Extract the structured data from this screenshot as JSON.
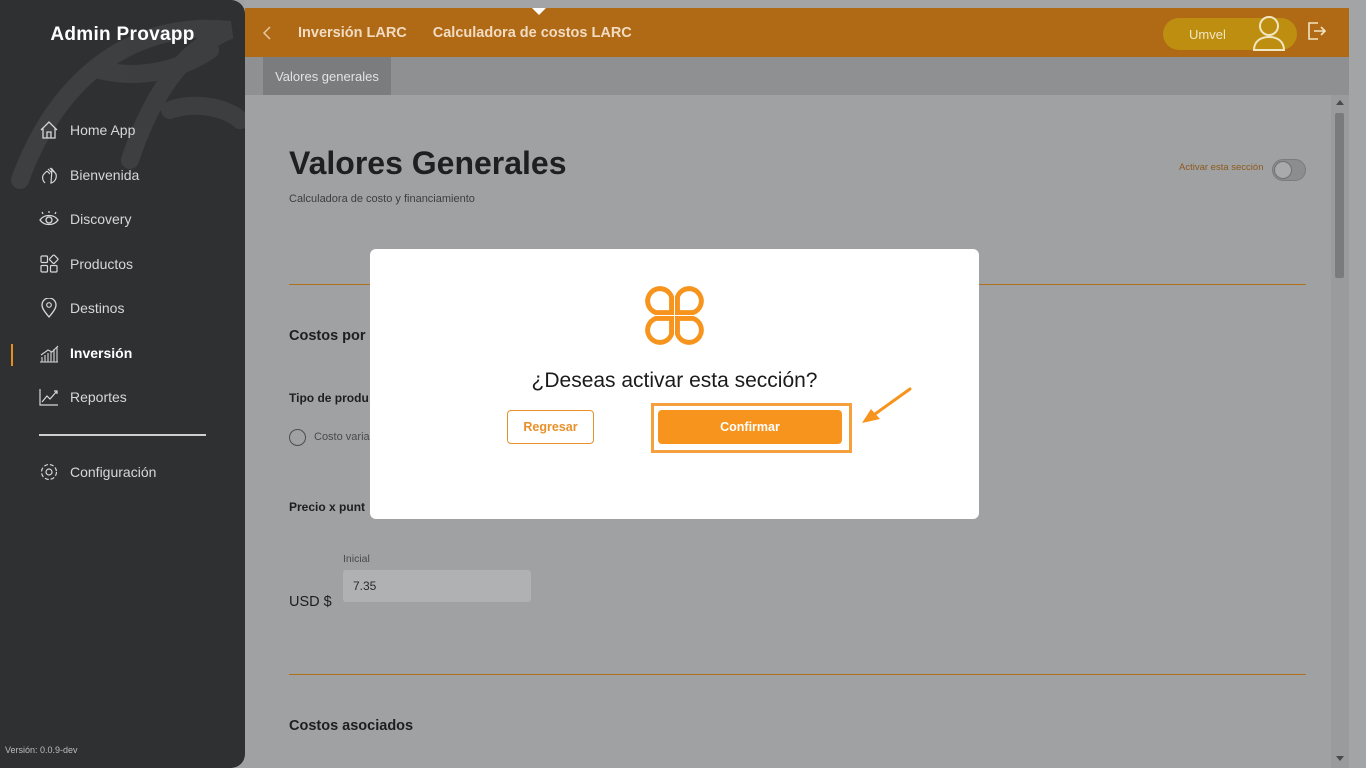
{
  "sidebar": {
    "title": "Admin Provapp",
    "items": [
      {
        "label": "Home App",
        "icon": "home-icon"
      },
      {
        "label": "Bienvenida",
        "icon": "wave-hand-icon"
      },
      {
        "label": "Discovery",
        "icon": "eye-icon"
      },
      {
        "label": "Productos",
        "icon": "grid-icon"
      },
      {
        "label": "Destinos",
        "icon": "location-pin-icon"
      },
      {
        "label": "Inversión",
        "icon": "bar-chart-icon",
        "active": true
      },
      {
        "label": "Reportes",
        "icon": "line-chart-icon"
      }
    ],
    "config_label": "Configuración",
    "version": "Versión: 0.0.9-dev"
  },
  "topbar": {
    "crumbs": [
      "Inversión LARC",
      "Calculadora de costos LARC"
    ],
    "user_name": "Umvel"
  },
  "subtabs": [
    "Valores generales"
  ],
  "main": {
    "title": "Valores Generales",
    "subtitle": "Calculadora de costo y financiamiento",
    "toggle_label": "Activar esta sección",
    "section_costs": "Costos por",
    "product_type_label": "Tipo de produ",
    "radio_label": "Costo varia",
    "price_label": "Precio x punt",
    "initial_label": "Inicial",
    "currency": "USD $",
    "initial_value": "7.35",
    "section_associated": "Costos asociados"
  },
  "modal": {
    "question": "¿Deseas activar esta sección?",
    "back_label": "Regresar",
    "confirm_label": "Confirmar"
  },
  "colors": {
    "accent": "#f7941d",
    "topbar": "#b06915",
    "sidebar": "#2f3031",
    "overlay_bg": "#a0a1a3"
  }
}
